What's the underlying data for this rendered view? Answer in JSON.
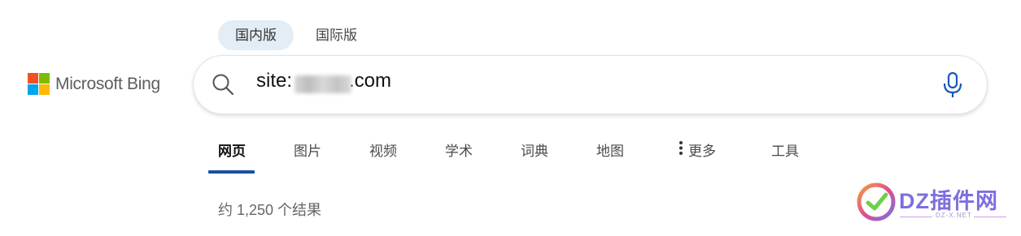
{
  "region_tabs": [
    {
      "label": "国内版",
      "active": true
    },
    {
      "label": "国际版",
      "active": false
    }
  ],
  "logo": {
    "text": "Microsoft Bing",
    "colors": [
      "#f25022",
      "#7fba00",
      "#00a4ef",
      "#ffb900"
    ]
  },
  "search": {
    "prefix": "site:",
    "suffix": ".com",
    "query_redacted": true
  },
  "nav": {
    "items": [
      {
        "label": "网页",
        "active": true
      },
      {
        "label": "图片"
      },
      {
        "label": "视频"
      },
      {
        "label": "学术"
      },
      {
        "label": "词典"
      },
      {
        "label": "地图"
      },
      {
        "label": "更多",
        "icon": "vertical-dots-icon"
      },
      {
        "label": "工具"
      }
    ],
    "active_color": "#1a4fa6"
  },
  "results": {
    "count_text": "约 1,250 个结果"
  },
  "watermark": {
    "text": "DZ插件网",
    "sub": "DZ-X.NET"
  }
}
